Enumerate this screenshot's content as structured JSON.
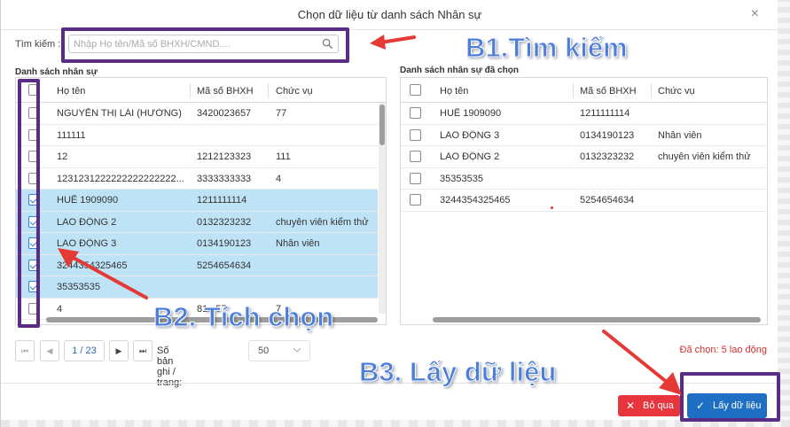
{
  "dialog": {
    "title": "Chọn dữ liệu từ danh sách Nhân sự",
    "close_glyph": "×"
  },
  "search": {
    "label": "Tìm kiếm :",
    "placeholder": "Nhập Họ tên/Mã số BHXH/CMND....",
    "value": ""
  },
  "left_grid": {
    "label": "Danh sách nhân sự",
    "columns": [
      "Họ tên",
      "Mã số BHXH",
      "Chức vụ"
    ],
    "rows": [
      {
        "name": "NGUYỄN THỊ LÁI (HƯỜNG)",
        "bhxh": "3420023657",
        "position": "77",
        "checked": false,
        "selected": false
      },
      {
        "name": "111111",
        "bhxh": "",
        "position": "",
        "checked": false,
        "selected": false
      },
      {
        "name": "12",
        "bhxh": "1212123323",
        "position": "111",
        "checked": false,
        "selected": false
      },
      {
        "name": "1231231222222222222222...",
        "bhxh": "3333333333",
        "position": "4",
        "checked": false,
        "selected": false
      },
      {
        "name": "HUẾ 1909090",
        "bhxh": "1211111114",
        "position": "",
        "checked": true,
        "selected": true
      },
      {
        "name": "LAO ĐỘNG 2",
        "bhxh": "0132323232",
        "position": "chuyên viên kiểm thử",
        "checked": true,
        "selected": true
      },
      {
        "name": "LAO ĐỘNG 3",
        "bhxh": "0134190123",
        "position": "Nhân viên",
        "checked": true,
        "selected": true
      },
      {
        "name": "3244354325465",
        "bhxh": "5254654634",
        "position": "",
        "checked": true,
        "selected": true
      },
      {
        "name": "35353535",
        "bhxh": "",
        "position": "",
        "checked": true,
        "selected": true
      },
      {
        "name": "4",
        "bhxh": "81...57",
        "position": "7",
        "checked": false,
        "selected": false
      }
    ]
  },
  "right_grid": {
    "label": "Danh sách nhân sự đã chọn",
    "columns": [
      "Họ tên",
      "Mã số BHXH",
      "Chức vụ"
    ],
    "rows": [
      {
        "name": "HUẾ 1909090",
        "bhxh": "1211111114",
        "position": ""
      },
      {
        "name": "LAO ĐỘNG 3",
        "bhxh": "0134190123",
        "position": "Nhân viên"
      },
      {
        "name": "LAO ĐỘNG 2",
        "bhxh": "0132323232",
        "position": "chuyên viên kiểm thử"
      },
      {
        "name": "35353535",
        "bhxh": "",
        "position": ""
      },
      {
        "name": "3244354325465",
        "bhxh": "5254654634",
        "position": ""
      }
    ]
  },
  "pager": {
    "page_display": "1 / 23",
    "first_glyph": "⏮",
    "prev_glyph": "◀",
    "next_glyph": "▶",
    "last_glyph": "⏭",
    "per_page_label": "Số bản ghi / trang:",
    "per_page_value": "50"
  },
  "footer": {
    "selected_count": "Đã chọn: 5 lao động",
    "cancel_label": "Bỏ qua",
    "cancel_icon": "✕",
    "ok_label": "Lấy dữ liệu",
    "ok_icon": "✓"
  },
  "annotations": {
    "step1": "B1.Tìm kiếm",
    "step2": "B2. Tích chọn",
    "step3": "B3. Lấy dữ liệu"
  },
  "colors": {
    "highlight_box": "#5b2c86",
    "annotation_text": "#4e7ed8",
    "arrow": "#e53935",
    "row_selected": "#bfe3f6",
    "cancel_button": "#e8343c",
    "ok_button": "#1f6fc4",
    "selected_count": "#d32f2f"
  }
}
